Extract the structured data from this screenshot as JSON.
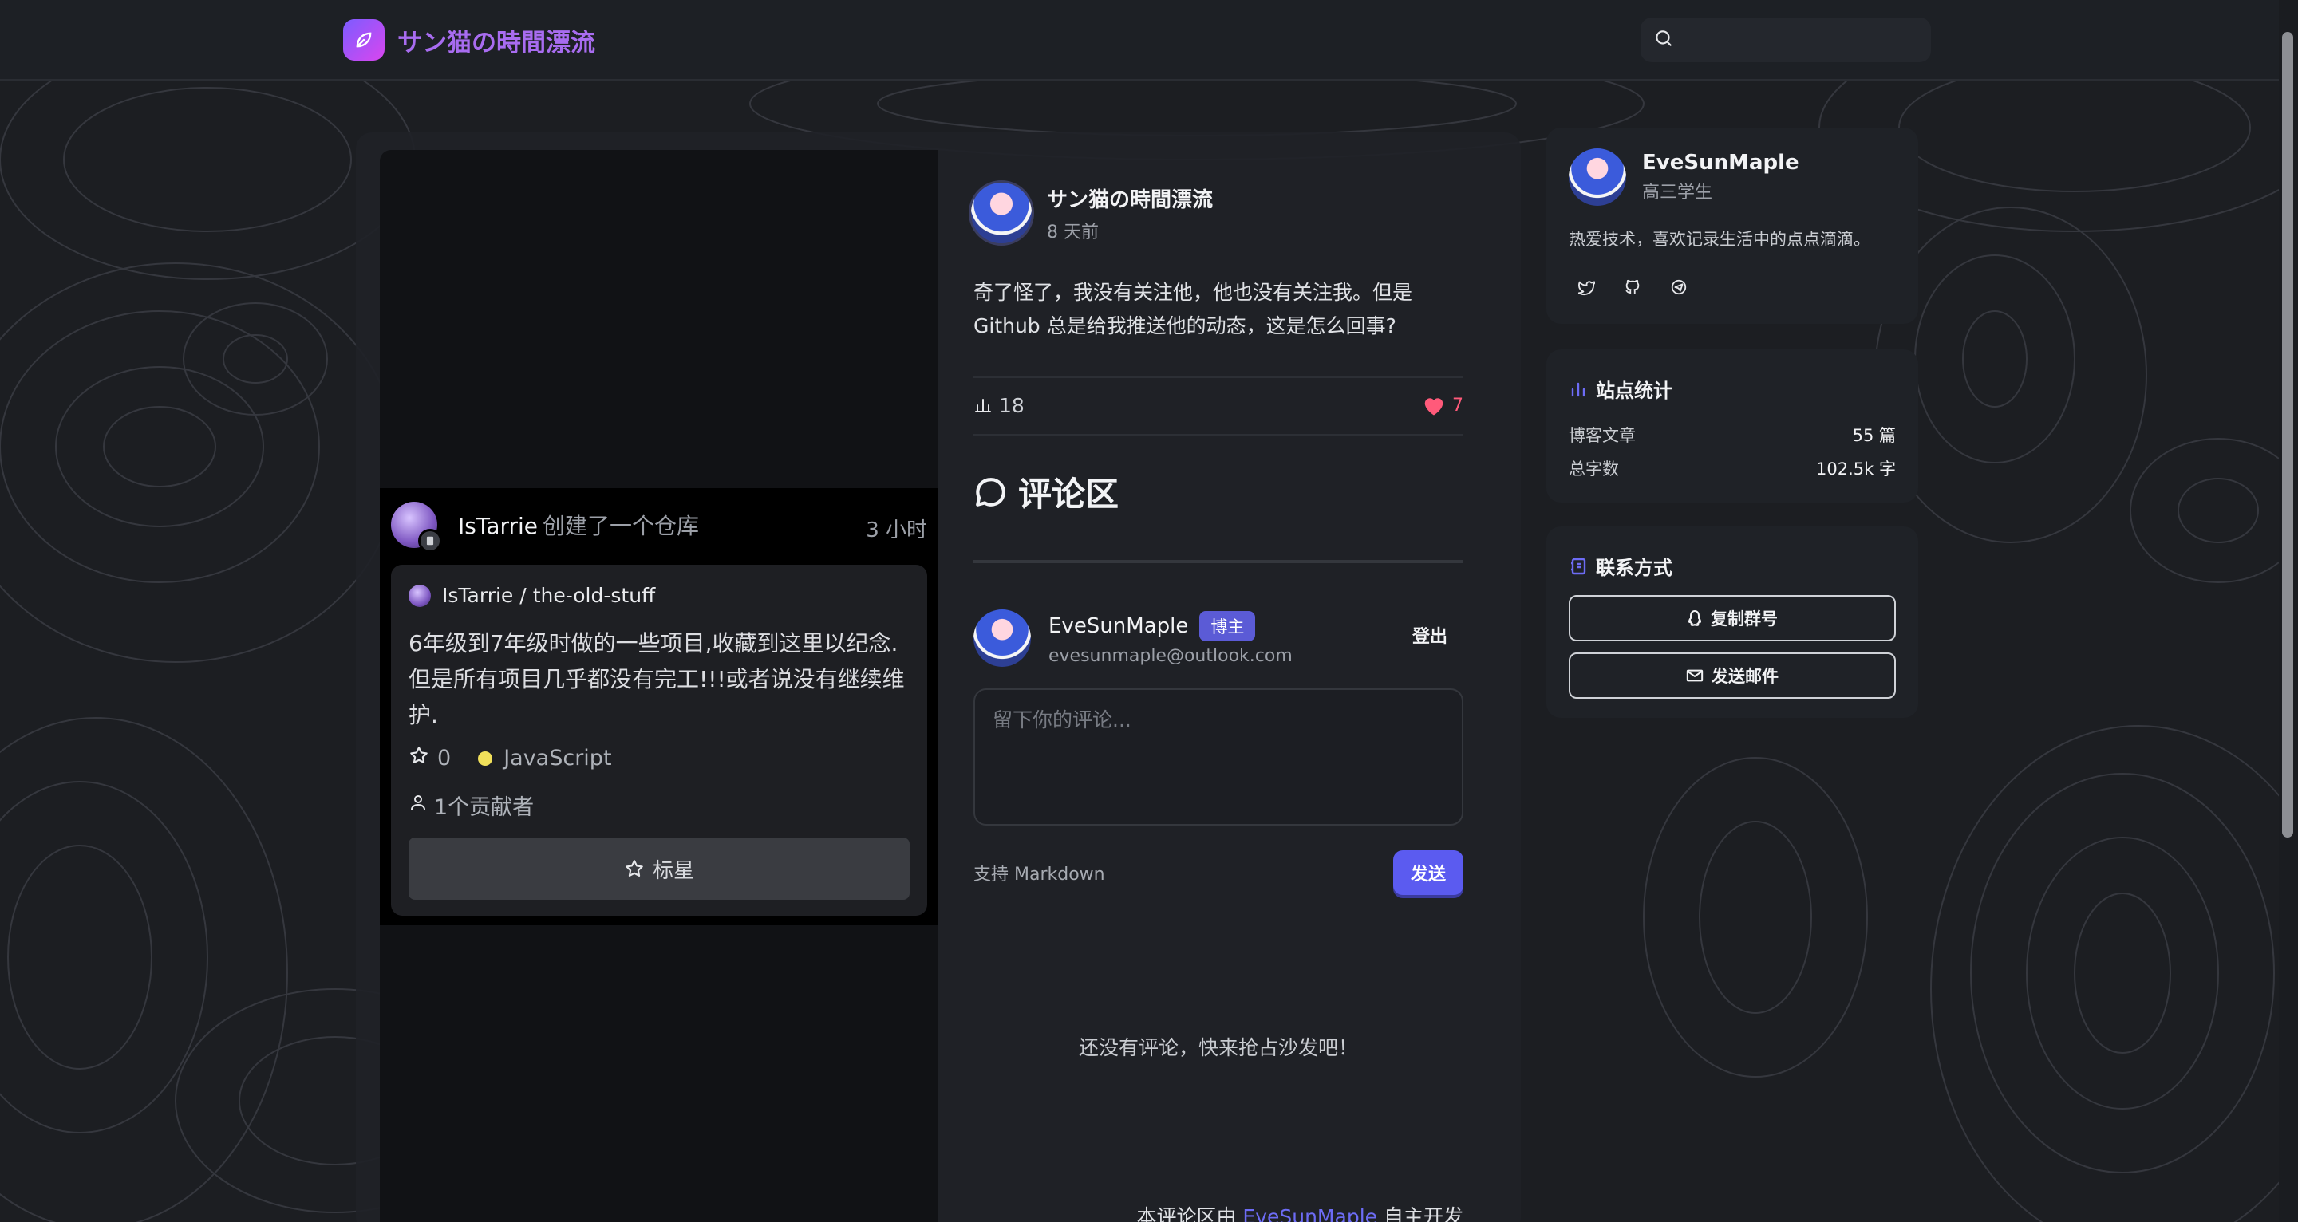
{
  "header": {
    "site_title": "サン猫の時間漂流",
    "search_placeholder": ""
  },
  "event": {
    "user": "IsTarrie",
    "action": "创建了一个仓库",
    "time": "3 小时",
    "repo": {
      "owner": "IsTarrie",
      "separator": "/",
      "name": "the-old-stuff",
      "description": "6年级到7年级时做的一些项目,收藏到这里以纪念.但是所有项目几乎都没有完工!!!或者说没有继续维护.",
      "stars": "0",
      "language": "JavaScript",
      "contributors": "1个贡献者",
      "star_button": "标星"
    }
  },
  "post": {
    "author": "サン猫の時間漂流",
    "time": "8 天前",
    "body": "奇了怪了，我没有关注他，他也没有关注我。但是 Github 总是给我推送他的动态，这是怎么回事?",
    "views": "18",
    "likes": "7"
  },
  "comments": {
    "title": "评论区",
    "user_name": "EveSunMaple",
    "owner_badge": "博主",
    "user_email": "evesunmaple@outlook.com",
    "logout": "登出",
    "input_placeholder": "留下你的评论...",
    "markdown_note": "支持 Markdown",
    "send": "发送",
    "empty": "还没有评论，快来抢占沙发吧！",
    "footer_prefix": "本评论区由",
    "footer_link": "EveSunMaple",
    "footer_suffix": "自主开发"
  },
  "sidebar": {
    "profile": {
      "name": "EveSunMaple",
      "role": "高三学生",
      "bio": "热爱技术，喜欢记录生活中的点点滴滴。",
      "social_icons": [
        "twitter-icon",
        "github-icon",
        "telegram-icon"
      ]
    },
    "stats": {
      "heading": "站点统计",
      "rows": [
        {
          "label": "博客文章",
          "value": "55 篇"
        },
        {
          "label": "总字数",
          "value": "102.5k 字"
        }
      ]
    },
    "contact": {
      "heading": "联系方式",
      "copy_group": "复制群号",
      "send_mail": "发送邮件"
    }
  },
  "colors": {
    "accent": "#5b5bf0",
    "brand": "#a86cf0",
    "like": "#ff5a7a",
    "language_js": "#f1e05a"
  }
}
